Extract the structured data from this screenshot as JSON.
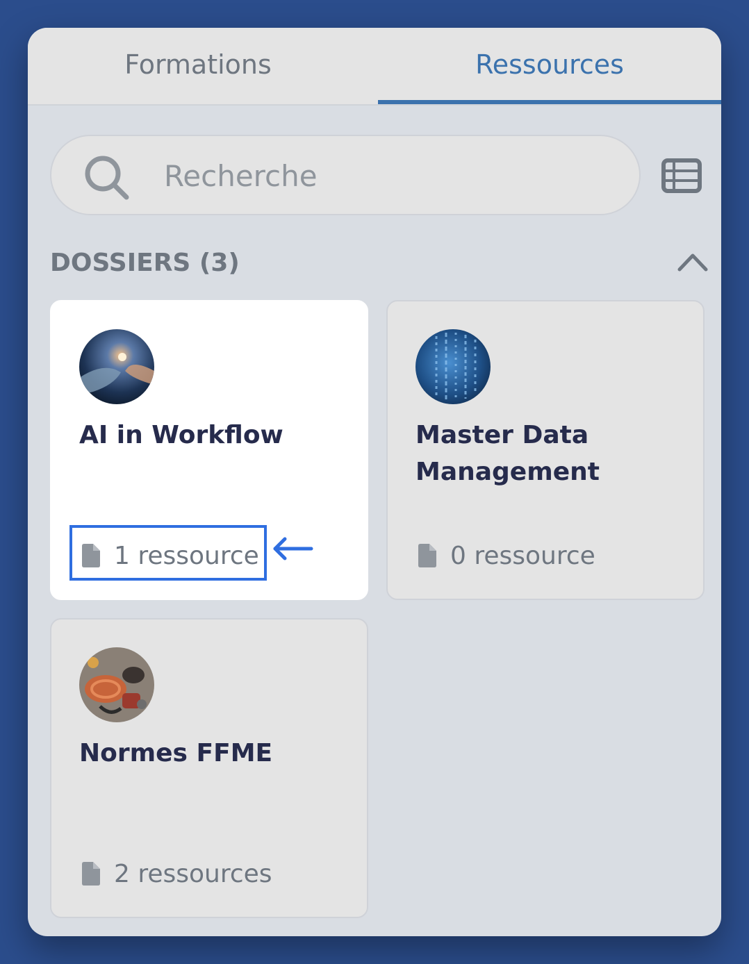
{
  "tabs": [
    {
      "label": "Formations",
      "active": false
    },
    {
      "label": "Ressources",
      "active": true
    }
  ],
  "search": {
    "placeholder": "Recherche",
    "value": "",
    "icon": "search-icon"
  },
  "view_toggle_icon": "list-view-icon",
  "section": {
    "title": "DOSSIERS (3)",
    "collapse_icon": "chevron-up-icon"
  },
  "folders": [
    {
      "title": "AI in Workflow",
      "count": "1 ressource",
      "active": true,
      "highlighted": true
    },
    {
      "title": "Master Data Management",
      "count": "0 ressource",
      "active": false
    },
    {
      "title": "Normes FFME",
      "count": "2 ressources",
      "active": false
    }
  ],
  "colors": {
    "accent": "#3b72ad",
    "background": "#2b4d8c",
    "panel": "#d9dde3",
    "title_text": "#262b4c",
    "muted_text": "#6e7680",
    "highlight": "#2f6ee0"
  }
}
